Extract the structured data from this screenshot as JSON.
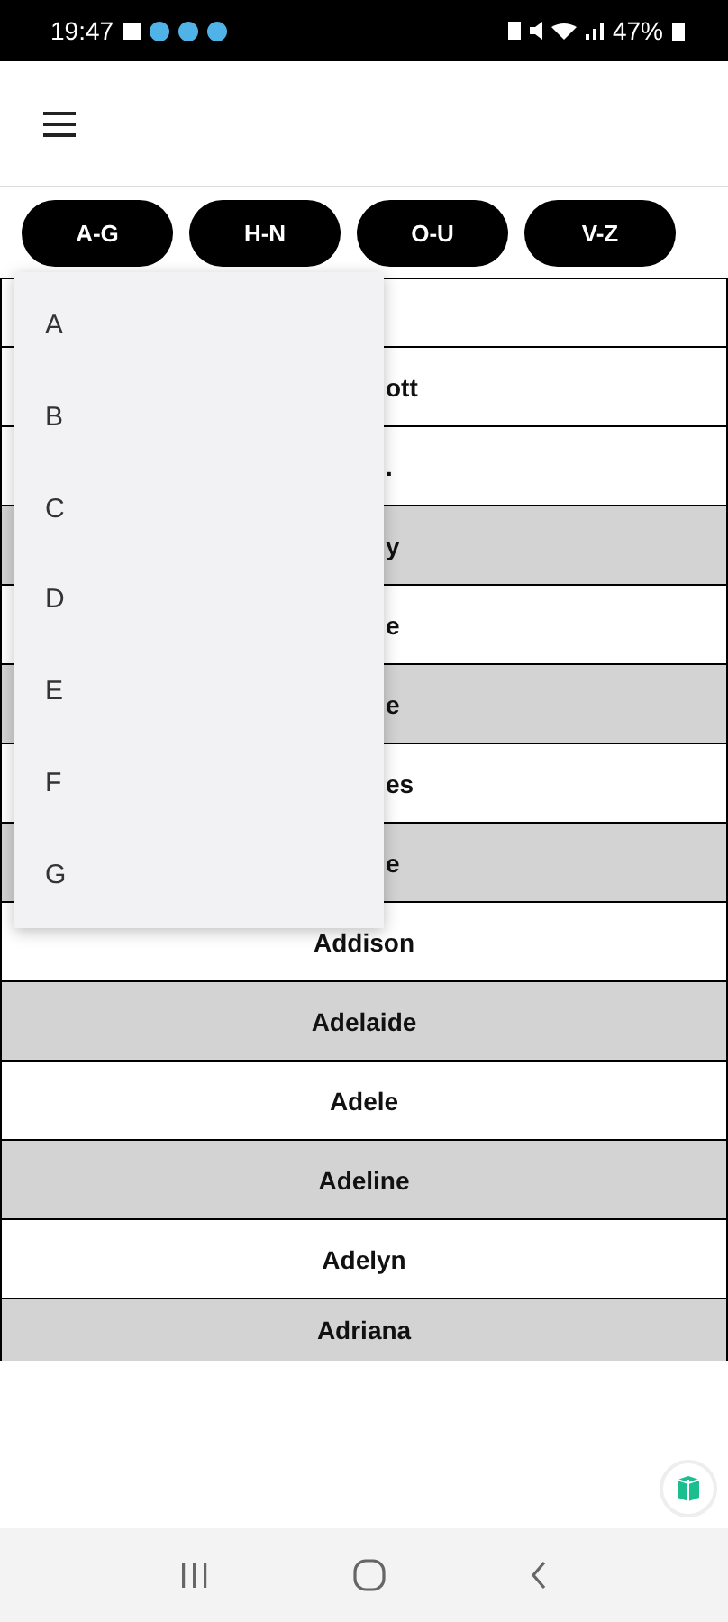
{
  "status_bar": {
    "time": "19:47",
    "battery": "47%"
  },
  "ranges": [
    {
      "label": "A-G"
    },
    {
      "label": "H-N"
    },
    {
      "label": "O-U"
    },
    {
      "label": "V-Z"
    }
  ],
  "rows": [
    {
      "shaded": false
    },
    {
      "name": "ott",
      "shaded": false,
      "covered": true
    },
    {
      "name": ".",
      "shaded": false,
      "covered": true
    },
    {
      "name": "y",
      "shaded": true,
      "covered": true
    },
    {
      "name": "e",
      "shaded": false,
      "covered": true
    },
    {
      "name": "e",
      "shaded": true,
      "covered": true
    },
    {
      "name": "es",
      "shaded": false,
      "covered": true
    },
    {
      "name": "e",
      "shaded": true,
      "covered": true
    },
    {
      "name": "Addison",
      "shaded": false,
      "covered": false
    },
    {
      "name": "Adelaide",
      "shaded": true,
      "covered": false
    },
    {
      "name": "Adele",
      "shaded": false,
      "covered": false
    },
    {
      "name": "Adeline",
      "shaded": true,
      "covered": false
    },
    {
      "name": "Adelyn",
      "shaded": false,
      "covered": false
    },
    {
      "name": "Adriana",
      "shaded": true,
      "covered": false
    }
  ],
  "letter_menu": [
    "A",
    "B",
    "C",
    "D",
    "E",
    "F",
    "G"
  ]
}
